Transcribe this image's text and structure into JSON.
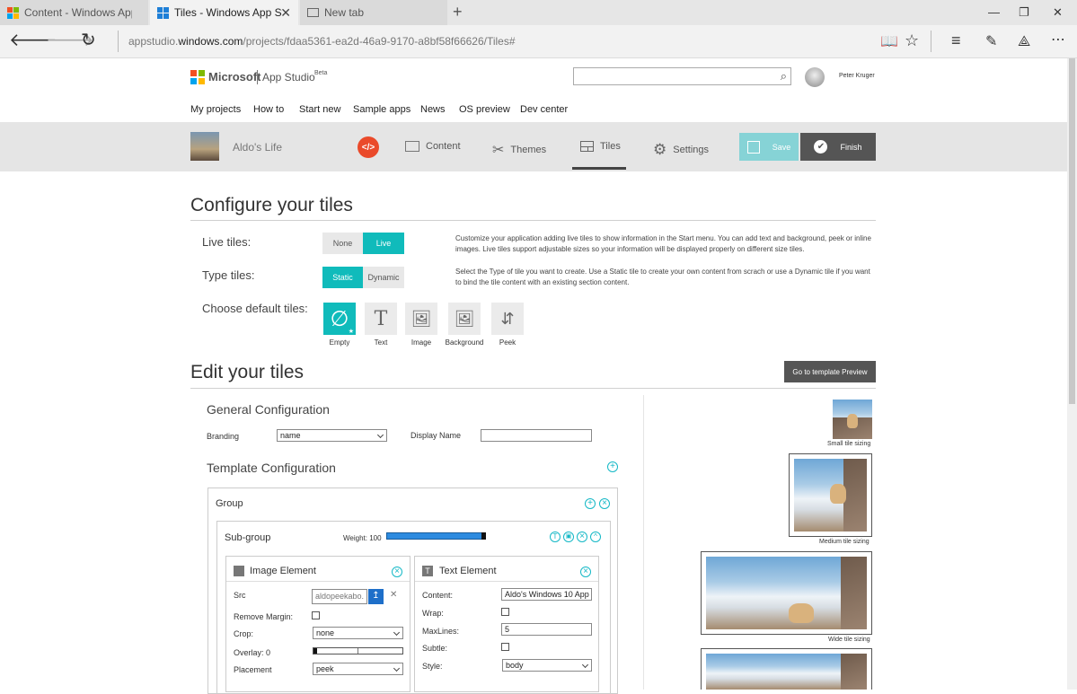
{
  "browser": {
    "tabs": [
      {
        "title": "Content - Windows App Stu",
        "active": false
      },
      {
        "title": "Tiles - Windows App Stu",
        "active": true
      },
      {
        "title": "New tab",
        "active": false
      }
    ],
    "url_prefix": "appstudio.",
    "url_domain": "windows.com",
    "url_path": "/projects/fdaa5361-ea2d-46a9-9170-a8bf58f66626/Tiles#"
  },
  "header": {
    "brand": "Microsoft",
    "product": "App Studio",
    "beta": "Beta",
    "user": "Peter Kruger",
    "nav": [
      "My projects",
      "How to",
      "Start new",
      "Sample apps",
      "News",
      "OS preview",
      "Dev center"
    ]
  },
  "project": {
    "name": "Aldo's Life",
    "tabs": [
      "Content",
      "Themes",
      "Tiles",
      "Settings"
    ],
    "active_tab": "Tiles",
    "save_label": "Save",
    "finish_label": "Finish"
  },
  "configure": {
    "title": "Configure your tiles",
    "live_tiles_label": "Live tiles:",
    "live_options": [
      "None",
      "Live"
    ],
    "live_selected": "Live",
    "live_desc": "Customize your application adding live tiles to show information in the Start menu. You can add text and background, peek or inline images. Live tiles support adjustable sizes so your information will be displayed properly on different size tiles.",
    "type_tiles_label": "Type tiles:",
    "type_options": [
      "Static",
      "Dynamic"
    ],
    "type_selected": "Static",
    "type_desc": "Select the Type of tile you want to create. Use a Static tile to create your own content from scrach or use a Dynamic tile if you want to bind the tile content with an existing section content.",
    "default_tiles_label": "Choose default tiles:",
    "default_tiles": [
      "Empty",
      "Text",
      "Image",
      "Background",
      "Peek"
    ]
  },
  "edit": {
    "title": "Edit your tiles",
    "preview_button": "Go to template Preview",
    "general_title": "General Configuration",
    "branding_label": "Branding",
    "branding_value": "name",
    "display_name_label": "Display Name",
    "display_name_value": "",
    "template_title": "Template Configuration",
    "group_label": "Group",
    "subgroup_label": "Sub-group",
    "weight_label": "Weight: 100",
    "weight_value": 100,
    "image_element": {
      "title": "Image Element",
      "src_label": "Src",
      "src_value": "aldopeekabo.",
      "remove_margin_label": "Remove Margin:",
      "crop_label": "Crop:",
      "crop_value": "none",
      "overlay_label": "Overlay: 0",
      "overlay_value": 0,
      "placement_label": "Placement",
      "placement_value": "peek"
    },
    "text_element": {
      "title": "Text Element",
      "content_label": "Content:",
      "content_value": "Aldo's Windows 10 App",
      "wrap_label": "Wrap:",
      "maxlines_label": "MaxLines:",
      "maxlines_value": "5",
      "subtle_label": "Subtle:",
      "style_label": "Style:",
      "style_value": "body"
    }
  },
  "preview": {
    "small_label": "Small tile sizing",
    "medium_label": "Medium tile sizing",
    "wide_label": "Wide tile sizing"
  },
  "colors": {
    "accent": "#10bbbb",
    "save_disabled": "#86d3d6",
    "finish": "#555555",
    "code_badge": "#ea4a2a",
    "weight_bar": "#2d8be0"
  }
}
